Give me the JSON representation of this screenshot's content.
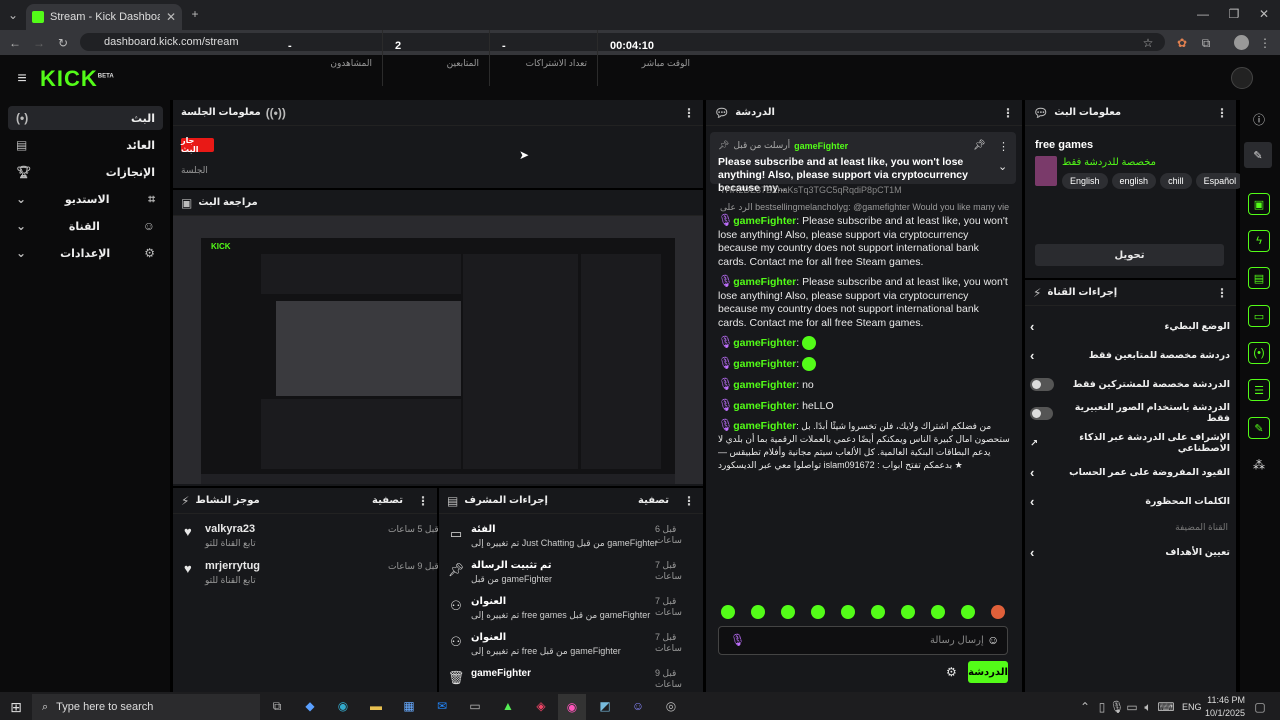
{
  "browser": {
    "tab_title": "Stream - Kick Dashboard",
    "url": "dashboard.kick.com/stream"
  },
  "brand": {
    "logo": "KICK",
    "beta": "BETA",
    "accent": "#53fc18"
  },
  "sidebar": {
    "items": [
      {
        "label": "البث",
        "icon": "broadcast-icon"
      },
      {
        "label": "العائد",
        "icon": "revenue-icon"
      },
      {
        "label": "الإنجازات",
        "icon": "trophy-icon"
      },
      {
        "label": "الاستديو",
        "icon": "studio-icon"
      },
      {
        "label": "القناة",
        "icon": "channel-icon"
      },
      {
        "label": "الإعدادات",
        "icon": "gear-icon"
      }
    ]
  },
  "session": {
    "title": "معلومات الجلسة",
    "live_badge": "جار البث",
    "live_label": "الجلسة",
    "viewers_value": "-",
    "viewers_label": "المشاهدون",
    "followers_value": "2",
    "followers_label": "المتابعين",
    "subs_value": "-",
    "subs_label": "تعداد الاشتراكات",
    "time_value": "00:04:10",
    "time_label": "الوقت مباشر"
  },
  "preview": {
    "title": "مراجعة البث"
  },
  "activity": {
    "title": "موجز النشاط",
    "filter": "تصفية",
    "items": [
      {
        "name": "valkyra23",
        "desc": "تابع القناة للتو",
        "time": "قبل 5 ساعات"
      },
      {
        "name": "mrjerrytug",
        "desc": "تابع القناة للتو",
        "time": "قبل 9 ساعات"
      }
    ]
  },
  "modactions": {
    "title": "إجراءات المشرف",
    "filter": "تصفية",
    "items": [
      {
        "title": "الفئة",
        "desc": "تم تغييره إلى Just Chatting من قبل gameFighter",
        "time": "قبل 6 ساعات"
      },
      {
        "title": "تم تثبيت الرسالة",
        "desc": "من قبل gameFighter",
        "time": "قبل 7 ساعات"
      },
      {
        "title": "العنوان",
        "desc": "تم تغييره إلى free games من قبل gameFighter",
        "time": "قبل 7 ساعات"
      },
      {
        "title": "العنوان",
        "desc": "تم تغييره إلى free من قبل gameFighter",
        "time": "قبل 7 ساعات"
      },
      {
        "title": "gameFighter",
        "desc": "",
        "time": "قبل 9 ساعات"
      }
    ]
  },
  "chat": {
    "title": "الدردشة",
    "pinned_by": "أرسلت من قبل",
    "pinned_user": "gameFighter",
    "pinned_text": "Please subscribe and at least like, you won't lose anything! Also, please support via cryptocurrency because my...",
    "truncated": "THR2DE37BZhaKsTq3TGC5qRqdiP8pCT1M",
    "reply_label": "الرد على",
    "reply_text": "bestsellingmelancholyg: @gamefighter Would you like many vie...",
    "messages": [
      {
        "user": "gameFighter",
        "text": ": Please subscribe and at least like, you won't lose anything! Also, please support via cryptocurrency because my country does not support international bank cards. Contact me for all free Steam games."
      },
      {
        "user": "gameFighter",
        "text": ": Please subscribe and at least like, you won't lose anything! Also, please support via cryptocurrency because my country does not support international bank cards. Contact me for all free Steam games."
      },
      {
        "user": "gameFighter",
        "text": ":"
      },
      {
        "user": "gameFighter",
        "text": ":"
      },
      {
        "user": "gameFighter",
        "text": ": no"
      },
      {
        "user": "gameFighter",
        "text": ": heLLO"
      },
      {
        "user": "gameFighter",
        "text": ": من فضلكم اشتراك ولايك، فلن تخسروا شيئًا أبدًا. بل ستحصون امال كبيرة الناس ويمكنكم أيضًا دعمي بالعملات الرقمية بما أن بلدي لا يدعم البطاقات البنكية العالمية. كل الألعاب سيتم مجانية وأفلام تطبيقس — تواصلوا معي عبر الديسكورد islam091672 : بدعمكم تفتح ابواب ★"
      }
    ],
    "input_placeholder": "إرسال رسالة",
    "send_label": "الدردشة"
  },
  "streaminfo": {
    "title": "معلومات البث",
    "stream_title": "free games",
    "category": "مخصصة للدردشة فقط",
    "tags": [
      "English",
      "english",
      "chill",
      "Español"
    ],
    "edit_label": "تحويل"
  },
  "channelactions": {
    "title": "إجراءات القناة",
    "items": [
      {
        "label": "الوضع البطيء",
        "kind": "chevron"
      },
      {
        "label": "دردشة مخصصة للمتابعين فقط",
        "kind": "chevron"
      },
      {
        "label": "الدردشة مخصصة للمشتركين فقط",
        "kind": "toggle"
      },
      {
        "label": "الدردشة باستخدام الصور التعبيرية فقط",
        "kind": "toggle"
      },
      {
        "label": "الإشراف على الدردشة عبر الذكاء الاصطناعي",
        "kind": "external"
      },
      {
        "label": "القيود المفروضة على عمر الحساب",
        "kind": "chevron"
      },
      {
        "label": "الكلمات المحظورة",
        "kind": "chevron"
      }
    ],
    "disabled_label": "القناة المضيفة",
    "goals_label": "تعيين الأهداف"
  },
  "taskbar": {
    "search_placeholder": "Type here to search",
    "lang": "ENG",
    "time": "11:46 PM",
    "date": "10/1/2025"
  }
}
